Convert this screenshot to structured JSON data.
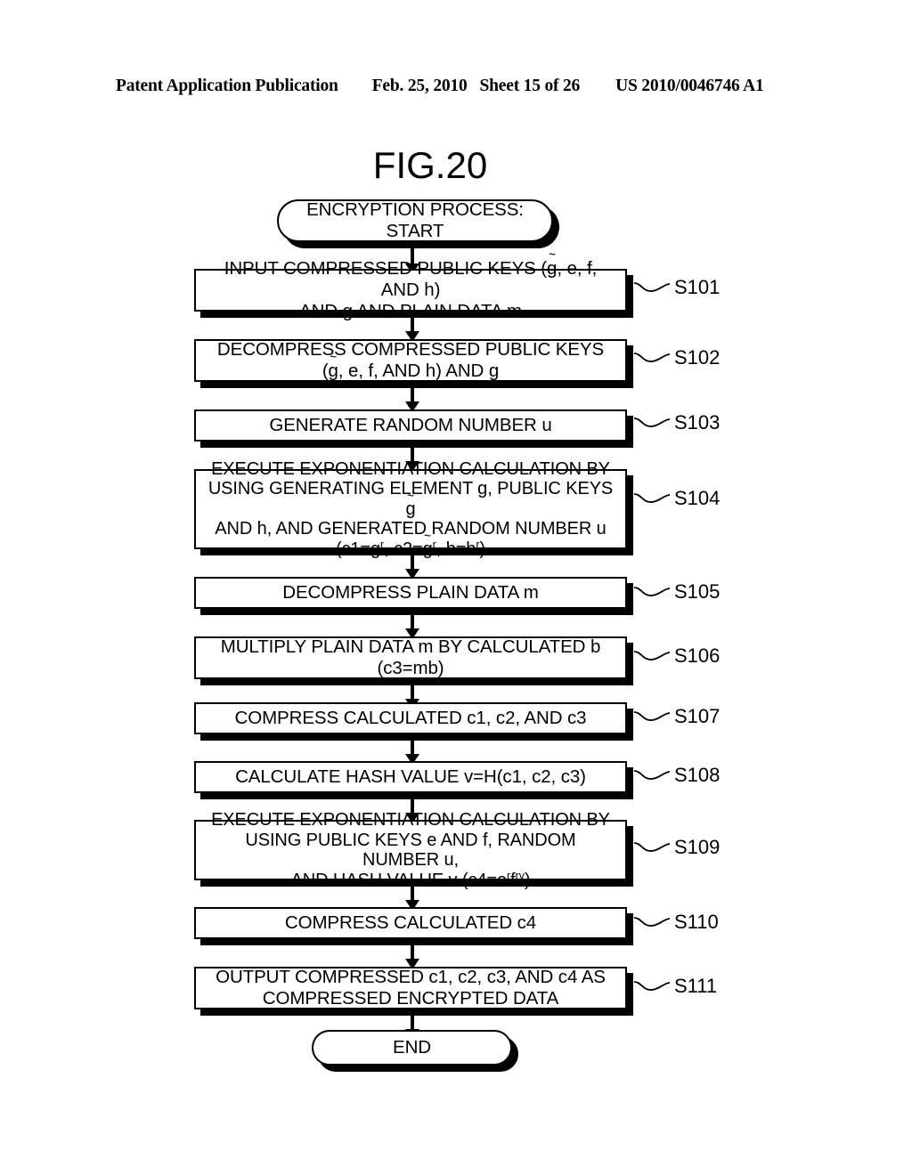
{
  "header": {
    "publication": "Patent Application Publication",
    "date": "Feb. 25, 2010",
    "sheet": "Sheet 15 of 26",
    "patent_number": "US 2010/0046746 A1"
  },
  "figure": {
    "title": "FIG.20"
  },
  "flowchart": {
    "type": "flowchart",
    "start": {
      "shape": "terminator",
      "text": "ENCRYPTION PROCESS:\nSTART"
    },
    "end": {
      "shape": "terminator",
      "text": "END"
    },
    "steps": [
      {
        "id": "S101",
        "shape": "process",
        "lines": [
          "INPUT COMPRESSED PUBLIC KEYS (g~, e, f, AND h)",
          "AND g AND PLAIN DATA m"
        ],
        "text": "INPUT COMPRESSED PUBLIC KEYS (g~, e, f, AND h) AND g AND PLAIN DATA m"
      },
      {
        "id": "S102",
        "shape": "process",
        "lines": [
          "DECOMPRESS COMPRESSED PUBLIC KEYS",
          "(g~, e, f, AND h) AND g"
        ],
        "text": "DECOMPRESS COMPRESSED PUBLIC KEYS (g~, e, f, AND h) AND g"
      },
      {
        "id": "S103",
        "shape": "process",
        "lines": [
          "GENERATE RANDOM NUMBER u"
        ],
        "text": "GENERATE RANDOM NUMBER u"
      },
      {
        "id": "S104",
        "shape": "process",
        "lines": [
          "EXECUTE EXPONENTIATION CALCULATION BY",
          "USING GENERATING ELEMENT g, PUBLIC KEYS g~",
          "AND h, AND GENERATED RANDOM NUMBER u",
          "(c1=g^r, c2=g~^r, b=h^r)"
        ],
        "text": "EXECUTE EXPONENTIATION CALCULATION BY USING GENERATING ELEMENT g, PUBLIC KEYS g~ AND h, AND GENERATED RANDOM NUMBER u (c1=g^r, c2=g~^r, b=h^r)"
      },
      {
        "id": "S105",
        "shape": "process",
        "lines": [
          "DECOMPRESS PLAIN DATA m"
        ],
        "text": "DECOMPRESS PLAIN DATA m"
      },
      {
        "id": "S106",
        "shape": "process",
        "lines": [
          "MULTIPLY PLAIN DATA m BY CALCULATED b",
          "(c3=mb)"
        ],
        "text": "MULTIPLY PLAIN DATA m BY CALCULATED b (c3=mb)"
      },
      {
        "id": "S107",
        "shape": "process",
        "lines": [
          "COMPRESS CALCULATED c1, c2, AND c3"
        ],
        "text": "COMPRESS CALCULATED c1, c2, AND c3"
      },
      {
        "id": "S108",
        "shape": "process",
        "lines": [
          "CALCULATE HASH VALUE v=H(c1, c2, c3)"
        ],
        "text": "CALCULATE HASH VALUE v=H(c1, c2, c3)"
      },
      {
        "id": "S109",
        "shape": "process",
        "lines": [
          "EXECUTE EXPONENTIATION CALCULATION BY",
          "USING PUBLIC KEYS e AND f, RANDOM NUMBER u,",
          "AND HASH VALUE v (c4=e^r f^rv)"
        ],
        "text": "EXECUTE EXPONENTIATION CALCULATION BY USING PUBLIC KEYS e AND f, RANDOM NUMBER u, AND HASH VALUE v (c4=e^r f^rv)"
      },
      {
        "id": "S110",
        "shape": "process",
        "lines": [
          "COMPRESS CALCULATED c4"
        ],
        "text": "COMPRESS CALCULATED c4"
      },
      {
        "id": "S111",
        "shape": "process",
        "lines": [
          "OUTPUT COMPRESSED c1, c2, c3, AND c4 AS",
          "COMPRESSED ENCRYPTED DATA"
        ],
        "text": "OUTPUT COMPRESSED c1, c2, c3, AND c4 AS COMPRESSED ENCRYPTED DATA"
      }
    ]
  }
}
